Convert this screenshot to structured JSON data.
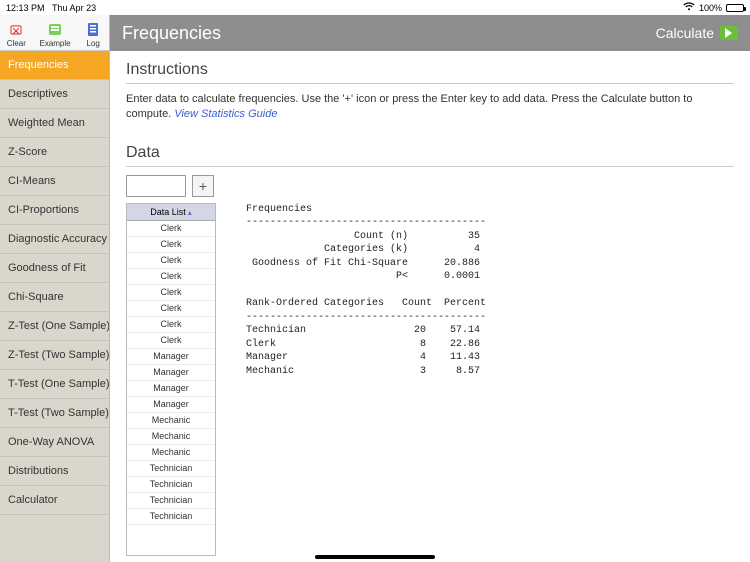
{
  "status": {
    "time": "12:13 PM",
    "date": "Thu Apr 23",
    "battery_pct": "100%"
  },
  "toolbar": {
    "clear": "Clear",
    "example": "Example",
    "log": "Log"
  },
  "sidebar": {
    "items": [
      {
        "label": "Frequencies",
        "active": true
      },
      {
        "label": "Descriptives"
      },
      {
        "label": "Weighted Mean"
      },
      {
        "label": "Z-Score"
      },
      {
        "label": "CI-Means"
      },
      {
        "label": "CI-Proportions"
      },
      {
        "label": "Diagnostic Accuracy"
      },
      {
        "label": "Goodness of Fit"
      },
      {
        "label": "Chi-Square"
      },
      {
        "label": "Z-Test (One Sample)"
      },
      {
        "label": "Z-Test (Two Sample)"
      },
      {
        "label": "T-Test (One Sample)"
      },
      {
        "label": "T-Test (Two Sample)"
      },
      {
        "label": "One-Way ANOVA"
      },
      {
        "label": "Distributions"
      },
      {
        "label": "Calculator"
      }
    ]
  },
  "header": {
    "title": "Frequencies",
    "calculate": "Calculate"
  },
  "instructions": {
    "heading": "Instructions",
    "body": "Enter data to calculate frequencies.  Use the '+' icon or press the Enter key to add data.  Press the Calculate button to compute.   ",
    "link": "View Statistics Guide"
  },
  "data": {
    "heading": "Data",
    "input_value": "",
    "plus": "+",
    "list_header": "Data List",
    "entries": [
      "Clerk",
      "Clerk",
      "Clerk",
      "Clerk",
      "Clerk",
      "Clerk",
      "Clerk",
      "Clerk",
      "Manager",
      "Manager",
      "Manager",
      "Manager",
      "Mechanic",
      "Mechanic",
      "Mechanic",
      "Technician",
      "Technician",
      "Technician",
      "Technician"
    ]
  },
  "output": "Frequencies\n----------------------------------------\n                  Count (n)          35\n             Categories (k)           4\n Goodness of Fit Chi-Square      20.886\n                         P<      0.0001\n\nRank-Ordered Categories   Count  Percent\n----------------------------------------\nTechnician                  20    57.14\nClerk                        8    22.86\nManager                      4    11.43\nMechanic                     3     8.57",
  "chart_data": {
    "type": "table",
    "title": "Frequencies",
    "summary": {
      "count_n": 35,
      "categories_k": 4,
      "goodness_of_fit_chi_square": 20.886,
      "p_less_than": 0.0001
    },
    "ranked_categories": [
      {
        "category": "Technician",
        "count": 20,
        "percent": 57.14
      },
      {
        "category": "Clerk",
        "count": 8,
        "percent": 22.86
      },
      {
        "category": "Manager",
        "count": 4,
        "percent": 11.43
      },
      {
        "category": "Mechanic",
        "count": 3,
        "percent": 8.57
      }
    ]
  }
}
